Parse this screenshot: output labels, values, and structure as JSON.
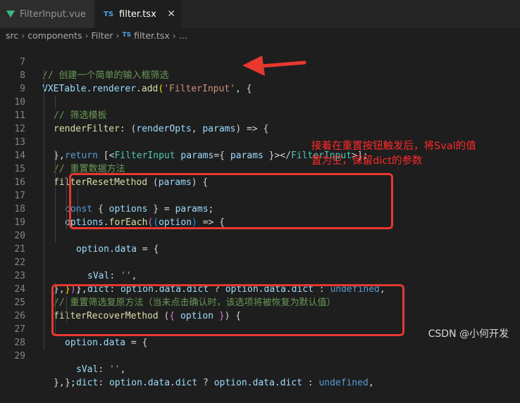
{
  "tabs": [
    {
      "label": "FilterInput.vue",
      "icon": "vue-icon",
      "active": false
    },
    {
      "label": "filter.tsx",
      "icon": "ts-icon",
      "icon_text": "TS",
      "active": true
    }
  ],
  "close_glyph": "✕",
  "breadcrumb": [
    "src",
    "components",
    "Filter",
    "filter.tsx",
    "..."
  ],
  "breadcrumb_sep": "›",
  "code": {
    "l7": {
      "n": "7",
      "comment": "// 创建一个简单的输入框筛选"
    },
    "l8": {
      "n": "8",
      "obj": "VXETable",
      "p1": ".",
      "prop": "renderer",
      "p2": ".",
      "fn": "add",
      "p3": "(",
      "str": "'FilterInput'",
      "p4": ", {"
    },
    "l9": {
      "n": "9",
      "comment": "// 筛选模板"
    },
    "l10": {
      "n": "10",
      "fn": "renderFilter",
      "p1": ": (",
      "a1": "renderOpts",
      "p2": ", ",
      "a2": "params",
      "p3": ") => {"
    },
    "l11": {
      "n": "11",
      "kw": "return",
      "p1": " [<",
      "tag": "FilterInput",
      "sp": " ",
      "attr": "params",
      "p2": "={ ",
      "val": "params",
      "p3": " }></",
      "tag2": "FilterInput",
      "p4": ">];"
    },
    "l12": {
      "n": "12",
      "text": "},"
    },
    "l13": {
      "n": "13",
      "comment": "// 重置数据方法"
    },
    "l14": {
      "n": "14",
      "fn": "filterResetMethod",
      "p1": " (",
      "arg": "params",
      "p2": ") {"
    },
    "l15": {
      "n": "15",
      "kw": "const",
      "p1": " { ",
      "var": "options",
      "p2": " } = ",
      "val": "params",
      "p3": ";"
    },
    "l16": {
      "n": "16",
      "var": "options",
      "p1": ".",
      "fn": "forEach",
      "b1": "(",
      "b2": "(",
      "arg": "option",
      "b3": ")",
      "p2": " => {"
    },
    "l17": {
      "n": "17",
      "obj": "option",
      "p1": ".",
      "prop": "data",
      "p2": " = {"
    },
    "l18": {
      "n": "18",
      "key": "sVal",
      "p1": ": ",
      "str": "''",
      "p2": ","
    },
    "l19": {
      "n": "19",
      "key": "dict",
      "p1": ": ",
      "o1": "option",
      "p2": ".",
      "o2": "data",
      "p3": ".",
      "o3": "dict",
      "p4": " ? ",
      "o4": "option",
      "p5": ".",
      "o5": "data",
      "p6": ".",
      "o6": "dict",
      "p7": " : ",
      "kw": "undefined",
      "p8": ","
    },
    "l20": {
      "n": "20",
      "text": "},"
    },
    "l21": {
      "n": "21",
      "b1": "}",
      "b2": ")",
      "p1": ";"
    },
    "l22": {
      "n": "22",
      "text": "},"
    },
    "l23": {
      "n": "23",
      "comment": "// 重置筛选复原方法（当未点击确认时，该选项将被恢复为默认值）"
    },
    "l24": {
      "n": "24",
      "fn": "filterRecoverMethod",
      "p1": " (",
      "b1": "{",
      "sp": " ",
      "arg": "option",
      "sp2": " ",
      "b2": "}",
      "p2": ") {"
    },
    "l25": {
      "n": "25",
      "obj": "option",
      "p1": ".",
      "prop": "data",
      "p2": " = {"
    },
    "l26": {
      "n": "26",
      "key": "sVal",
      "p1": ": ",
      "str": "''",
      "p2": ","
    },
    "l27": {
      "n": "27",
      "key": "dict",
      "p1": ": ",
      "o1": "option",
      "p2": ".",
      "o2": "data",
      "p3": ".",
      "o3": "dict",
      "p4": " ? ",
      "o4": "option",
      "p5": ".",
      "o5": "data",
      "p6": ".",
      "o6": "dict",
      "p7": " : ",
      "kw": "undefined",
      "p8": ","
    },
    "l28": {
      "n": "28",
      "text": "};"
    },
    "l29": {
      "n": "29",
      "text": "},"
    }
  },
  "annotation_lines": [
    "接着在重置按钮触发后，将Sval的值",
    "置为空，保留dict的参数"
  ],
  "watermark": "CSDN @小何开发",
  "colors": {
    "highlight": "#e8382f",
    "annotation_text": "#ff2a2a",
    "background": "#1e1e1e"
  }
}
